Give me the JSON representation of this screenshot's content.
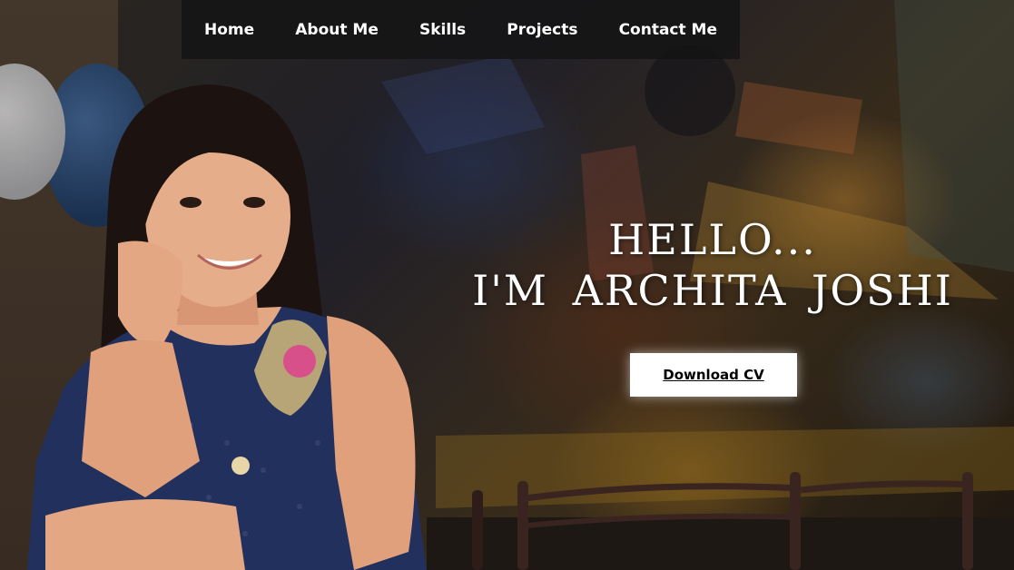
{
  "nav": {
    "items": [
      {
        "label": "Home"
      },
      {
        "label": "About Me"
      },
      {
        "label": "Skills"
      },
      {
        "label": "Projects"
      },
      {
        "label": "Contact Me"
      }
    ]
  },
  "hero": {
    "greeting": "HELLO...",
    "name_line": "I'M  ARCHITA  JOSHI",
    "cta_label": "Download CV"
  },
  "colors": {
    "nav_bg": "#141414",
    "text": "#ffffff",
    "button_bg": "#ffffff",
    "button_text": "#000000"
  }
}
